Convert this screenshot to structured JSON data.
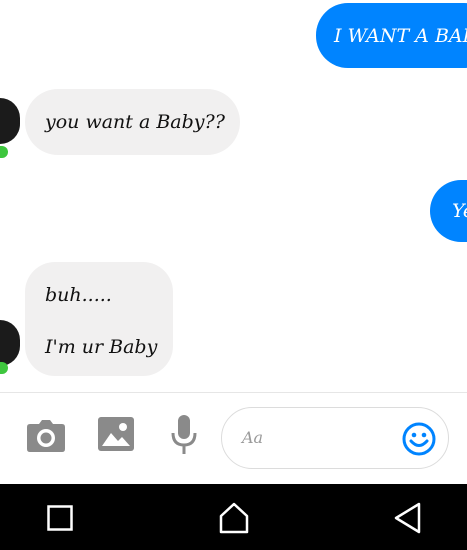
{
  "messages": [
    {
      "direction": "outgoing",
      "text": "I WANT A BAB"
    },
    {
      "direction": "incoming",
      "text": "you want a Baby??"
    },
    {
      "direction": "outgoing",
      "text": "Ye"
    },
    {
      "direction": "incoming",
      "lines": [
        "buh.....",
        "I'm ur Baby"
      ]
    }
  ],
  "composer": {
    "placeholder": "Aa",
    "icons": [
      "camera-icon",
      "image-icon",
      "microphone-icon",
      "emoji-icon"
    ]
  },
  "navbar": {
    "icons": [
      "recent-apps-icon",
      "home-icon",
      "back-icon"
    ]
  },
  "colors": {
    "outgoing_bubble": "#0084ff",
    "incoming_bubble": "#f1f0f0",
    "accent": "#0084ff",
    "online": "#3ec63e"
  }
}
